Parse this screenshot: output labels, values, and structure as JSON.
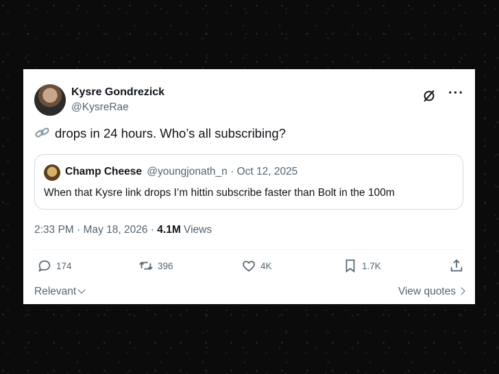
{
  "author": {
    "display_name": "Kysre Gondrezick",
    "handle": "@KysreRae"
  },
  "tweet": {
    "emoji": "link-emoji",
    "text": "drops in 24 hours. Who’s all subscribing?"
  },
  "quote": {
    "display_name": "Champ Cheese",
    "handle": "@youngjonath_n",
    "separator": "·",
    "date": "Oct 12, 2025",
    "text": "When that Kysre link drops I’m hittin subscribe faster than Bolt in the 100m"
  },
  "meta": {
    "time": "2:33 PM",
    "sep1": "·",
    "date": "May 18, 2026",
    "sep2": "·",
    "views_count": "4.1M",
    "views_label": "Views"
  },
  "actions": {
    "replies": "174",
    "reposts": "396",
    "likes": "4K",
    "bookmarks": "1.7K"
  },
  "footer": {
    "sort_label": "Relevant",
    "view_quotes_label": "View quotes"
  },
  "colors": {
    "text": "#0f1419",
    "secondary": "#536471",
    "border": "#cfd9de",
    "background": "#0b0b0b"
  }
}
